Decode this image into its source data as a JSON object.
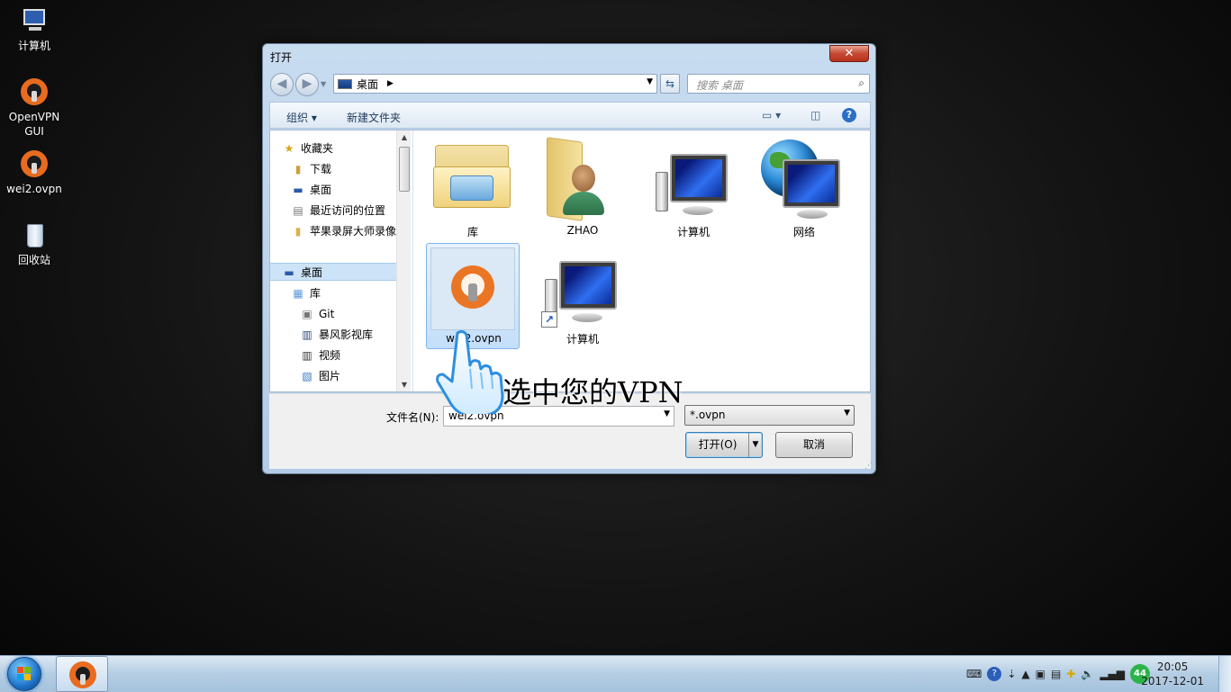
{
  "desktop": {
    "icons": [
      {
        "label": "计算机",
        "icon": "computer-icon"
      },
      {
        "label": "OpenVPN\nGUI",
        "icon": "openvpn-icon"
      },
      {
        "label": "wei2.ovpn",
        "icon": "openvpn-icon"
      },
      {
        "label": "回收站",
        "icon": "recycle-bin-icon"
      }
    ]
  },
  "dialog": {
    "title": "打开",
    "close_glyph": "✕",
    "address": {
      "current": "桌面"
    },
    "search": {
      "placeholder": "搜索 桌面"
    },
    "toolbar": {
      "organize": "组织 ▾",
      "new_folder": "新建文件夹"
    },
    "nav_pane": {
      "items": [
        {
          "label": "收藏夹",
          "icon": "star-icon"
        },
        {
          "label": "下载",
          "icon": "download-folder-icon"
        },
        {
          "label": "桌面",
          "icon": "desktop-icon"
        },
        {
          "label": "最近访问的位置",
          "icon": "recent-places-icon"
        },
        {
          "label": "苹果录屏大师录像",
          "icon": "folder-icon"
        },
        {
          "label": "桌面",
          "icon": "desktop-icon"
        },
        {
          "label": "库",
          "icon": "library-icon"
        },
        {
          "label": "Git",
          "icon": "git-icon"
        },
        {
          "label": "暴风影视库",
          "icon": "film-icon"
        },
        {
          "label": "视频",
          "icon": "video-icon"
        },
        {
          "label": "图片",
          "icon": "picture-icon"
        }
      ]
    },
    "files": [
      {
        "label": "库",
        "icon": "library-folder-icon"
      },
      {
        "label": "ZHAO",
        "icon": "user-folder-icon"
      },
      {
        "label": "计算机",
        "icon": "computer-icon"
      },
      {
        "label": "网络",
        "icon": "network-icon"
      },
      {
        "label": "wei2.ovpn",
        "icon": "openvpn-file-icon",
        "selected": true
      },
      {
        "label": "计算机",
        "icon": "computer-shortcut-icon"
      }
    ],
    "filename": {
      "label": "文件名(N):",
      "value": "wei2.ovpn"
    },
    "filter": {
      "value": "*.ovpn"
    },
    "buttons": {
      "open": "打开(O)",
      "cancel": "取消"
    }
  },
  "annotation": "选中您的VPN",
  "taskbar": {
    "net_badge": "44",
    "time": "20:05",
    "date": "2017-12-01"
  },
  "colors": {
    "selection": "#cde3f7",
    "openvpn_orange": "#ea7524",
    "close_red": "#c74a33"
  }
}
